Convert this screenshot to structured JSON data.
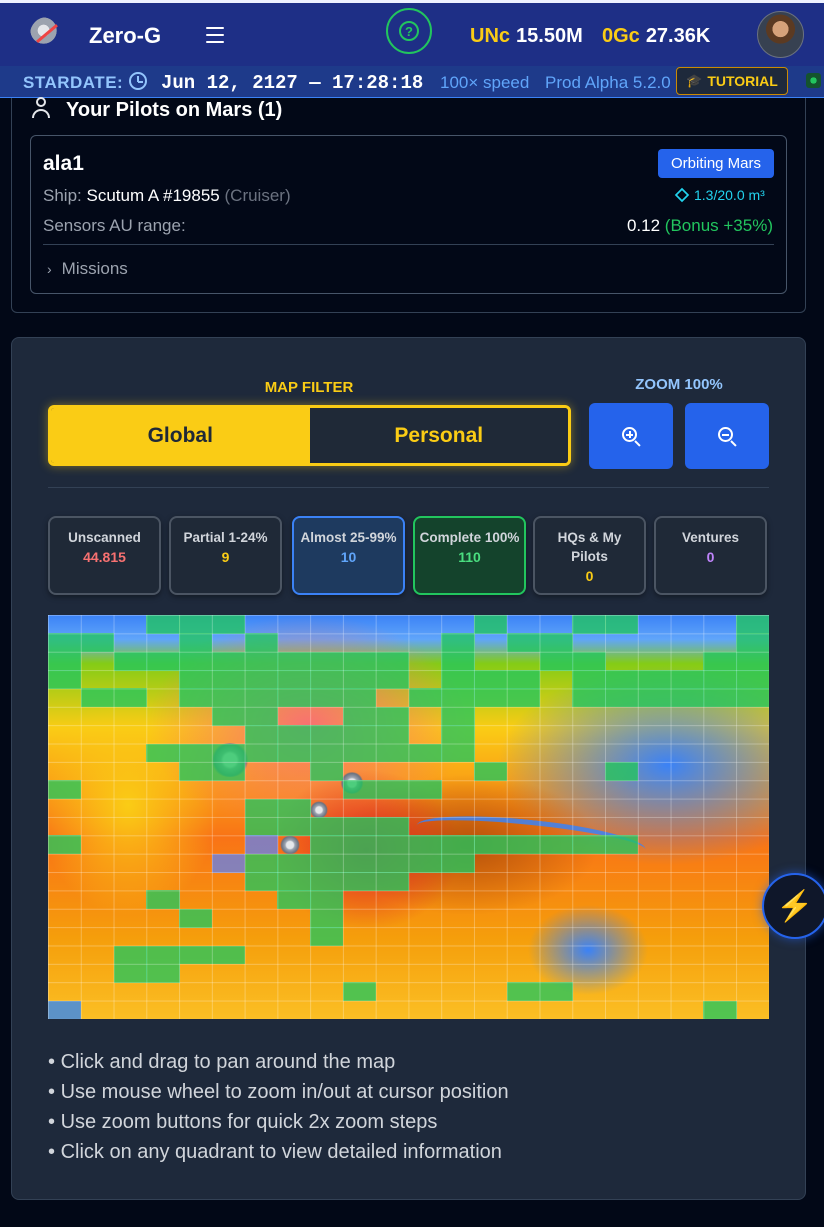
{
  "header": {
    "brand": "Zero-G",
    "unc_label": "UNc",
    "unc_value": "15.50M",
    "ogc_label": "0Gc",
    "ogc_value": "27.36K",
    "help_glyph": "?"
  },
  "stardate": {
    "label": "STARDATE:",
    "time": "Jun 12, 2127 — 17:28:18",
    "speed": "100× speed",
    "version": "Prod Alpha 5.2.0",
    "tutorial_label": "TUTORIAL"
  },
  "pilots": {
    "title": "Your Pilots on Mars (1)",
    "pilot": {
      "name": "ala1",
      "status": "Orbiting Mars",
      "ship_prefix": "Ship:",
      "ship_name": "Scutum A #19855",
      "ship_class": "(Cruiser)",
      "cargo": "1.3/20.0 m³",
      "sensors_label": "Sensors AU range:",
      "sensors_value": "0.12",
      "sensors_bonus": "(Bonus +35%)",
      "missions_label": "Missions"
    }
  },
  "map_controls": {
    "filter_title": "MAP FILTER",
    "filter_global": "Global",
    "filter_personal": "Personal",
    "active_filter": "Global",
    "zoom_label": "ZOOM 100%"
  },
  "stats": [
    {
      "label": "Unscanned",
      "value": "44.815",
      "color": "#f87171"
    },
    {
      "label": "Partial 1-24%",
      "value": "9",
      "color": "#facc15"
    },
    {
      "label": "Almost 25-99%",
      "value": "10",
      "color": "#60a5fa"
    },
    {
      "label": "Complete 100%",
      "value": "110",
      "color": "#4ade80"
    },
    {
      "label": "HQs & My Pilots",
      "value": "0",
      "color": "#facc15"
    },
    {
      "label": "Ventures",
      "value": "0",
      "color": "#c084fc"
    }
  ],
  "instructions": [
    "Click and drag to pan around the map",
    "Use mouse wheel to zoom in/out at cursor position",
    "Use zoom buttons for quick 2x zoom steps",
    "Click on any quadrant to view detailed information"
  ],
  "icons": {
    "logo": "rocket-planet-icon",
    "menu": "hamburger-icon",
    "help": "question-icon",
    "clock": "clock-icon",
    "tutorial": "graduation-cap-icon",
    "user": "user-icon",
    "cargo": "cube-icon",
    "zoom_in": "zoom-in-icon",
    "zoom_out": "zoom-out-icon",
    "quick_action": "lightning-icon"
  },
  "colors": {
    "accent_yellow": "#facc15",
    "accent_blue": "#2563eb",
    "success_green": "#22c55e",
    "header_bg": "#1e2f86"
  }
}
